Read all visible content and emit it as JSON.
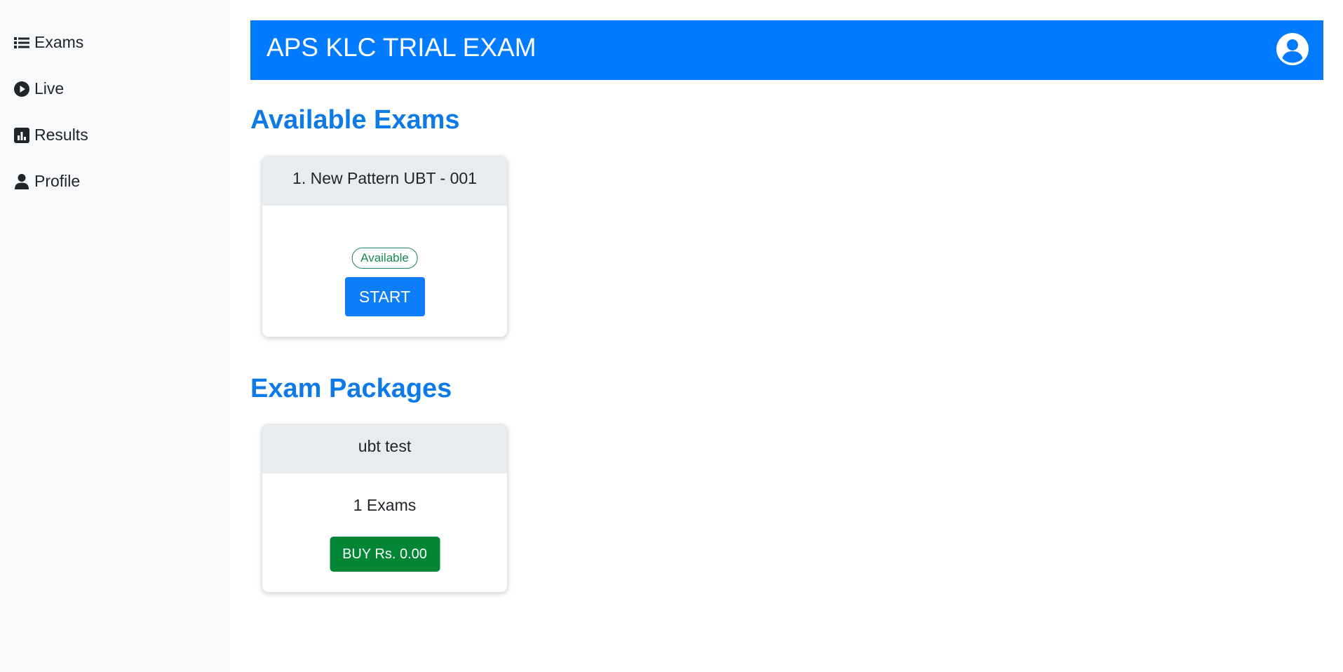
{
  "sidebar": {
    "items": [
      {
        "label": "Exams",
        "icon": "list-icon"
      },
      {
        "label": "Live",
        "icon": "play-circle-icon"
      },
      {
        "label": "Results",
        "icon": "bar-chart-icon"
      },
      {
        "label": "Profile",
        "icon": "person-icon"
      }
    ]
  },
  "header": {
    "title": "APS KLC TRIAL EXAM",
    "user_icon": "user-circle-icon"
  },
  "available_exams": {
    "title": "Available Exams",
    "cards": [
      {
        "title": "1. New Pattern UBT - 001",
        "status": "Available",
        "button": "START"
      }
    ]
  },
  "exam_packages": {
    "title": "Exam Packages",
    "cards": [
      {
        "title": "ubt test",
        "count": "1 Exams",
        "button": "BUY Rs. 0.00"
      }
    ]
  },
  "colors": {
    "header_bg": "#007bff",
    "section_title": "#0d7ae8",
    "start_button": "#0d7ef8",
    "buy_button": "#028535",
    "available_badge": "#198754"
  }
}
